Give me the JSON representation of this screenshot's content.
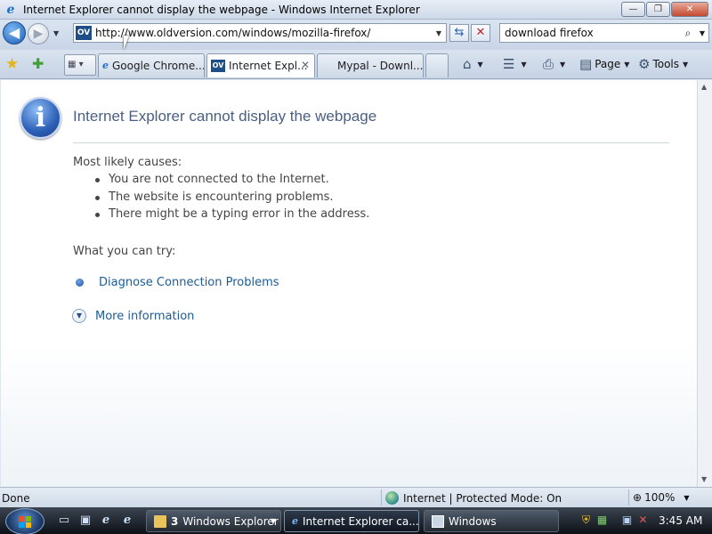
{
  "window": {
    "title": "Internet Explorer cannot display the webpage - Windows Internet Explorer",
    "controls": {
      "minimize": "—",
      "maximize": "❐",
      "close": "✕"
    }
  },
  "address_bar": {
    "url": "http://www.oldversion.com/windows/mozilla-firefox/",
    "site_icon": "OV",
    "refresh_icon": "⇆",
    "stop_icon": "✕"
  },
  "search": {
    "value": "download firefox",
    "icon": "⌕"
  },
  "tabs": [
    {
      "label": "Google Chrome...",
      "icon": "e",
      "active": false
    },
    {
      "label": "Internet Expl...",
      "icon": "OV",
      "active": true,
      "close": "✕"
    },
    {
      "label": "Mypal - Downl...",
      "icon": "",
      "active": false
    }
  ],
  "commands": {
    "home_icon": "⌂",
    "feeds_icon": "☰",
    "print_icon": "⎙",
    "page_label": "Page",
    "tools_label": "Tools"
  },
  "page": {
    "title": "Internet Explorer cannot display the webpage",
    "causes_heading": "Most likely causes:",
    "causes": [
      "You are not connected to the Internet.",
      "The website is encountering problems.",
      "There might be a typing error in the address."
    ],
    "try_heading": "What you can try:",
    "diagnose_link": "Diagnose Connection Problems",
    "more_info_link": "More information"
  },
  "status_bar": {
    "status": "Done",
    "zone": "Internet | Protected Mode: On",
    "zoom": "100%"
  },
  "taskbar": {
    "buttons": [
      {
        "count": "3",
        "label": "Windows Explorer"
      },
      {
        "label": "Internet Explorer ca..."
      },
      {
        "label": "Windows"
      }
    ],
    "clock": "3:45 AM"
  },
  "colors": {
    "accent": "#1f6fc5",
    "link": "#1c5c96",
    "title_text": "#4a5f82"
  }
}
